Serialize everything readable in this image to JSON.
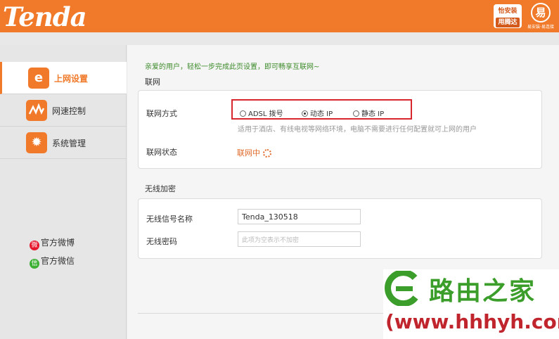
{
  "header": {
    "brand": "Tenda",
    "badge1_line1": "怡安装",
    "badge1_line2": "用腾达",
    "badge2_char": "易",
    "badge2_caption": "易安装·易连接"
  },
  "sidebar": {
    "items": [
      {
        "label": "上网设置",
        "icon": "internet-icon",
        "active": true
      },
      {
        "label": "网速控制",
        "icon": "speed-control-icon",
        "active": false
      },
      {
        "label": "系统管理",
        "icon": "gear-icon",
        "active": false
      }
    ],
    "social": [
      {
        "label": "官方微博",
        "icon": "weibo-icon"
      },
      {
        "label": "官方微信",
        "icon": "wechat-icon"
      }
    ]
  },
  "main": {
    "intro": "亲爱的用户，轻松一步完成此页设置，即可畅享互联网~",
    "network": {
      "title": "联网",
      "mode_label": "联网方式",
      "options": [
        "ADSL 拨号",
        "动态 IP",
        "静态 IP"
      ],
      "selected": "动态 IP",
      "hint": "适用于酒店、有线电视等网络环境，电脑不需要进行任何配置就可上网的用户",
      "status_label": "联网状态",
      "status_value": "联网中"
    },
    "wireless": {
      "title": "无线加密",
      "ssid_label": "无线信号名称",
      "ssid_value": "Tenda_130518",
      "password_label": "无线密码",
      "password_placeholder": "此项为空表示不加密"
    }
  },
  "watermark": {
    "chinese": "路由之家",
    "url": "www.hhhyh.com",
    "prefix": "(",
    "suffix": ")"
  },
  "colors": {
    "accent": "#f07a2a",
    "highlight_border": "#d8262e",
    "intro_green": "#3d8b2a"
  }
}
